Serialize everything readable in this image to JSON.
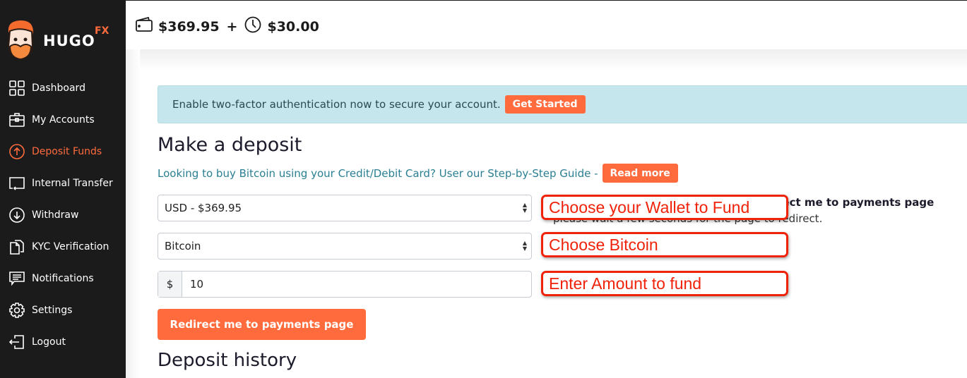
{
  "brand": {
    "name": "HUGO",
    "suffix": "FX"
  },
  "sidebar": {
    "items": [
      {
        "label": "Dashboard",
        "icon": "grid-icon",
        "active": false
      },
      {
        "label": "My Accounts",
        "icon": "briefcase-icon",
        "active": false
      },
      {
        "label": "Deposit Funds",
        "icon": "arrow-up-circle-icon",
        "active": true
      },
      {
        "label": "Internal Transfer",
        "icon": "transfer-icon",
        "active": false
      },
      {
        "label": "Withdraw",
        "icon": "arrow-down-circle-icon",
        "active": false
      },
      {
        "label": "KYC Verification",
        "icon": "documents-icon",
        "active": false
      },
      {
        "label": "Notifications",
        "icon": "message-icon",
        "active": false
      },
      {
        "label": "Settings",
        "icon": "gear-icon",
        "active": false
      },
      {
        "label": "Logout",
        "icon": "logout-icon",
        "active": false
      }
    ]
  },
  "topbar": {
    "balance": "$369.95",
    "plus": "+",
    "pending": "$30.00"
  },
  "alert": {
    "text": "Enable two-factor authentication now to secure your account.",
    "button": "Get Started"
  },
  "deposit": {
    "title": "Make a deposit",
    "guide_text": "Looking to buy Bitcoin using your Credit/Debit Card? User our Step-by-Step Guide -",
    "guide_button": "Read more",
    "wallet_select": "USD - $369.95",
    "method_select": "Bitcoin",
    "currency_addon": "$",
    "amount": "10",
    "submit": "Redirect me to payments page",
    "behind_heading": "rect me to payments page",
    "behind_text": "please wait a few seconds for the page to redirect."
  },
  "history": {
    "title": "Deposit history"
  },
  "annotations": {
    "wallet": "Choose your Wallet to Fund",
    "method": "Choose Bitcoin",
    "amount": "Enter Amount to fund"
  },
  "colors": {
    "accent": "#ff6b3d",
    "sidebar": "#1b1b1b",
    "alert": "#c4e6ec",
    "callout": "#f0220a",
    "link": "#2a7f93"
  }
}
